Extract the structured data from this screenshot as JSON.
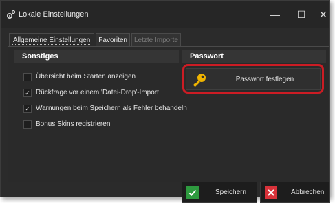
{
  "window": {
    "title": "Lokale Einstellungen",
    "icon": "gear-icon",
    "controls": {
      "minimize": "—",
      "maximize": "☐",
      "close": "✕"
    }
  },
  "tabs": [
    {
      "label": "Allgemeine Einstellungen",
      "active": true,
      "enabled": true
    },
    {
      "label": "Favoriten",
      "active": false,
      "enabled": true
    },
    {
      "label": "Letzte Importe",
      "active": false,
      "enabled": false
    }
  ],
  "sonstiges": {
    "header": "Sonstiges",
    "options": [
      {
        "label": "Übersicht beim Starten anzeigen",
        "checked": false
      },
      {
        "label": "Rückfrage vor einem 'Datei-Drop'-Import",
        "checked": true
      },
      {
        "label": "Warnungen beim Speichern als Fehler behandeln",
        "checked": true
      },
      {
        "label": "Bonus Skins registrieren",
        "checked": false
      }
    ]
  },
  "passwort": {
    "header": "Passwort",
    "button_label": "Passwort festlegen",
    "icon": "key-icon",
    "highlight_color": "#cc1c24"
  },
  "footer": {
    "save_label": "Speichern",
    "cancel_label": "Abbrechen",
    "save_icon": "checkmark-icon",
    "cancel_icon": "x-icon",
    "save_color": "#2e9a3f",
    "cancel_color": "#d8323a"
  }
}
